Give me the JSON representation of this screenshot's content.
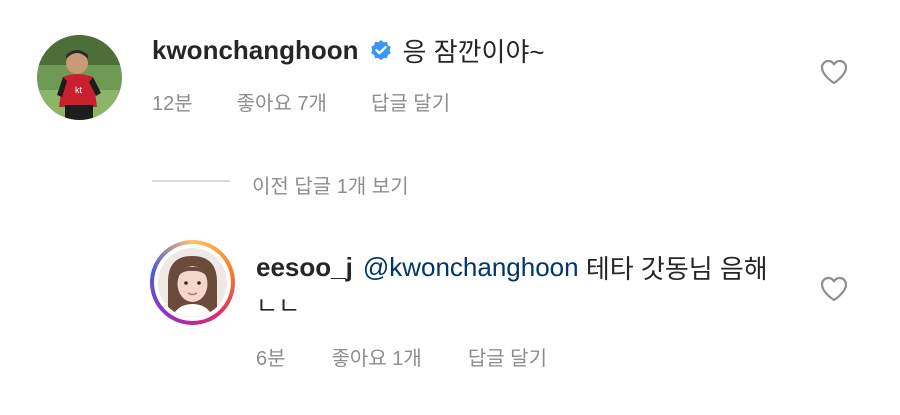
{
  "comment": {
    "username": "kwonchanghoon",
    "verified": true,
    "text": "응 잠깐이야~",
    "time": "12분",
    "likes": "좋아요 7개",
    "reply_label": "답글 달기"
  },
  "replies_toggle": {
    "label": "이전 답글 1개 보기"
  },
  "reply": {
    "username": "eesoo_j",
    "mention": "@kwonchanghoon",
    "text": " 테타 갓동님 음해",
    "text_line2": "ㄴㄴ",
    "time": "6분",
    "likes": "좋아요 1개",
    "reply_label": "답글 달기"
  },
  "colors": {
    "verified_badge": "#3897f0",
    "meta": "#8e8e8e",
    "mention": "#00376b"
  },
  "icons": {
    "like": "heart-outline-icon",
    "verified": "verified-badge-icon"
  }
}
